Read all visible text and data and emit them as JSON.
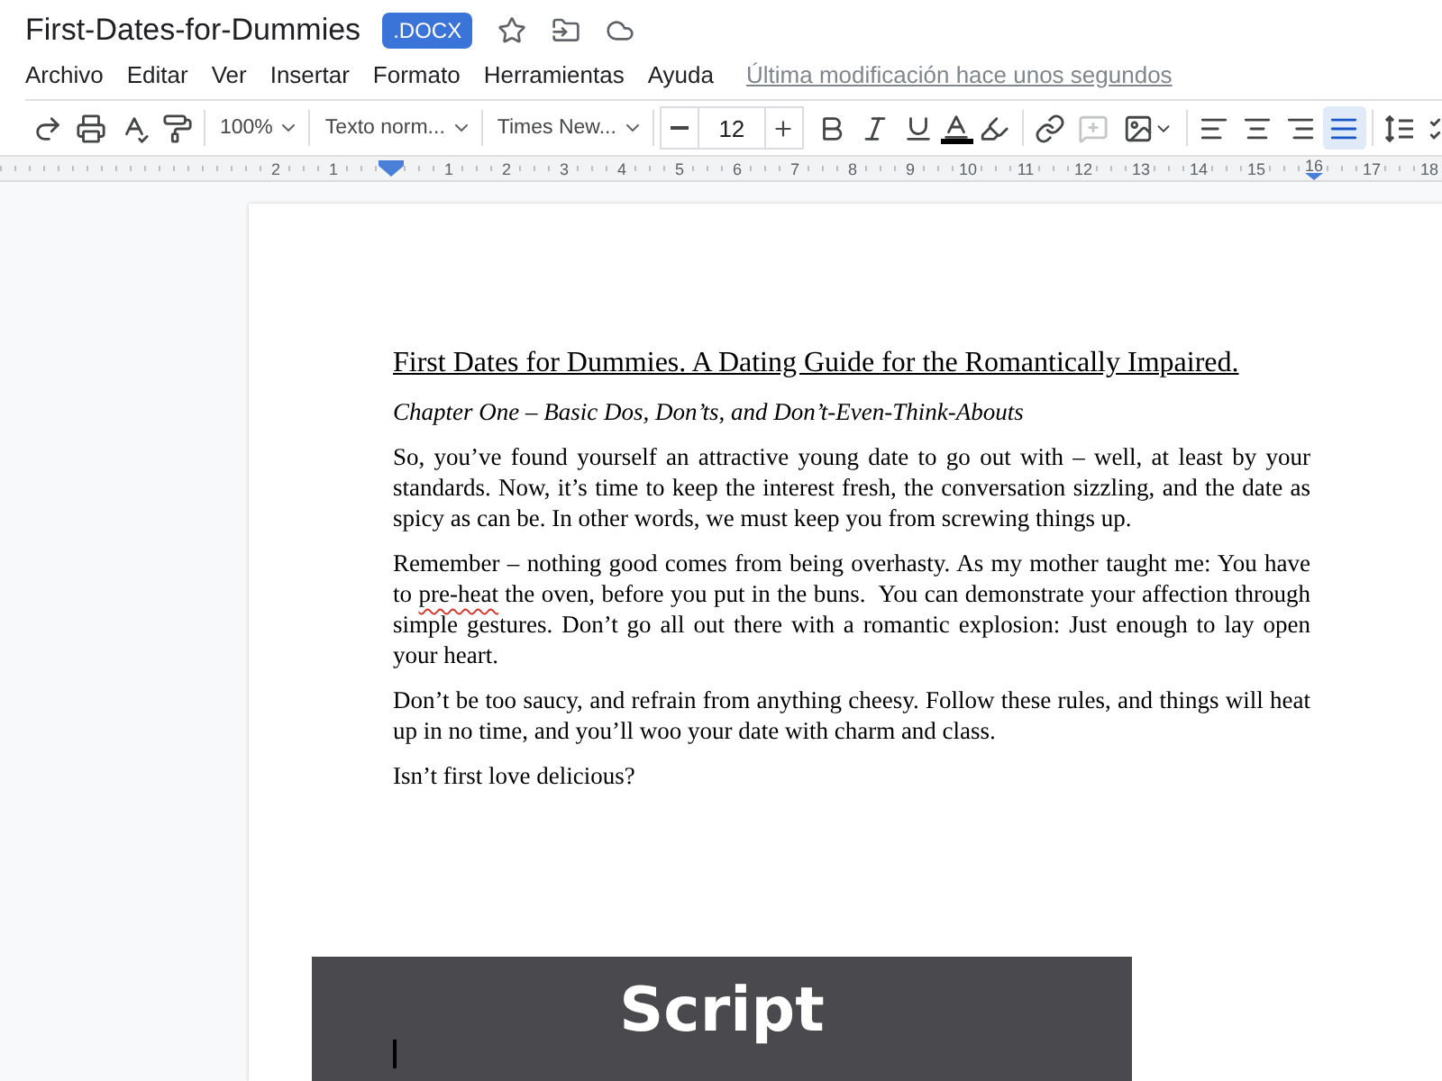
{
  "document_title": "First-Dates-for-Dummies",
  "file_badge": ".DOCX",
  "menu": [
    "Archivo",
    "Editar",
    "Ver",
    "Insertar",
    "Formato",
    "Herramientas",
    "Ayuda"
  ],
  "last_edit": "Última modificación hace unos segundos",
  "toolbar": {
    "zoom": "100%",
    "style": "Texto norm...",
    "font": "Times New...",
    "font_size": "12",
    "comment_button": {
      "disabled": true
    },
    "align_buttons": [
      {
        "selected": false
      },
      {
        "selected": false
      },
      {
        "selected": false
      },
      {
        "selected": true
      }
    ]
  },
  "ruler": [
    {
      "kind": "number",
      "label": "2"
    },
    {
      "kind": "number",
      "label": "1"
    },
    {
      "kind": "left_indent"
    },
    {
      "kind": "number",
      "label": "1"
    },
    {
      "kind": "number",
      "label": "2"
    },
    {
      "kind": "number",
      "label": "3"
    },
    {
      "kind": "number",
      "label": "4"
    },
    {
      "kind": "number",
      "label": "5"
    },
    {
      "kind": "number",
      "label": "6"
    },
    {
      "kind": "number",
      "label": "7"
    },
    {
      "kind": "number",
      "label": "8"
    },
    {
      "kind": "number",
      "label": "9"
    },
    {
      "kind": "number",
      "label": "10"
    },
    {
      "kind": "number",
      "label": "11"
    },
    {
      "kind": "number",
      "label": "12"
    },
    {
      "kind": "number",
      "label": "13"
    },
    {
      "kind": "number",
      "label": "14"
    },
    {
      "kind": "number",
      "label": "15"
    },
    {
      "kind": "right_indent",
      "label": "16"
    },
    {
      "kind": "number",
      "label": "17"
    },
    {
      "kind": "number",
      "label": "18"
    }
  ],
  "paragraphs": [
    {
      "kind": "title",
      "spans": [
        {
          "text": "First Dates for Dummies. A Dating Guide for the Romantically Impaired.",
          "misspelled": false
        }
      ]
    },
    {
      "kind": "subtitle",
      "spans": [
        {
          "text": "Chapter One – Basic Dos, Don’ts, and Don’t-Even-Think-Abouts",
          "misspelled": false
        }
      ]
    },
    {
      "kind": "body",
      "spans": [
        {
          "text": "So, you’ve found yourself an attractive young date to go out with – well, at least by your standards. Now, it’s time to keep the interest fresh, the conversation sizzling, and the date as spicy as can be. In other words, we must keep you from screwing things up.",
          "misspelled": false
        }
      ]
    },
    {
      "kind": "body",
      "spans": [
        {
          "text": "Remember – nothing good comes from being overhasty. As my mother taught me: You have to ",
          "misspelled": false
        },
        {
          "text": "pre-heat",
          "misspelled": true
        },
        {
          "text": " the oven, before you put in the buns.  You can demonstrate your affection through simple gestures. Don’t go all out there with a romantic explosion: Just enough to lay open your heart.",
          "misspelled": false
        }
      ]
    },
    {
      "kind": "body",
      "spans": [
        {
          "text": "Don’t be too saucy, and refrain from anything cheesy. Follow these rules, and things will heat up in no time, and you’ll woo your date with charm and class.",
          "misspelled": false
        }
      ]
    },
    {
      "kind": "body",
      "spans": [
        {
          "text": "Isn’t first love delicious?",
          "misspelled": false
        }
      ]
    }
  ],
  "banner": {
    "text": "Script"
  }
}
